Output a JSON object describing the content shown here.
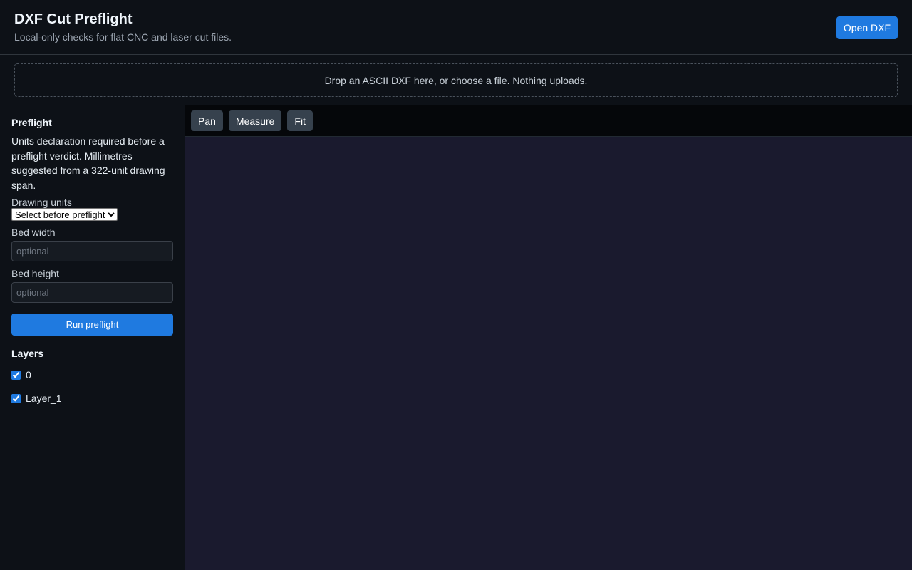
{
  "header": {
    "title": "DXF Cut Preflight",
    "subtitle": "Local-only checks for flat CNC and laser cut files.",
    "open_label": "Open DXF"
  },
  "dropzone": {
    "text": "Drop an ASCII DXF here, or choose a file. Nothing uploads."
  },
  "sidebar": {
    "preflight_title": "Preflight",
    "notice": "Units declaration required before a preflight verdict. Millimetres suggested from a 322-unit drawing span.",
    "units_label": "Drawing units",
    "units_selected": "Select before preflight",
    "bed_width_label": "Bed width",
    "bed_width_placeholder": "optional",
    "bed_height_label": "Bed height",
    "bed_height_placeholder": "optional",
    "run_label": "Run preflight",
    "layers_title": "Layers",
    "layers": [
      {
        "name": "0",
        "checked": true
      },
      {
        "name": "Layer_1",
        "checked": true
      }
    ]
  },
  "toolbar": {
    "pan_label": "Pan",
    "measure_label": "Measure",
    "fit_label": "Fit"
  },
  "colors": {
    "accent": "#1f7ae0",
    "background": "#0d1117",
    "canvas": "#1a1a2e"
  }
}
